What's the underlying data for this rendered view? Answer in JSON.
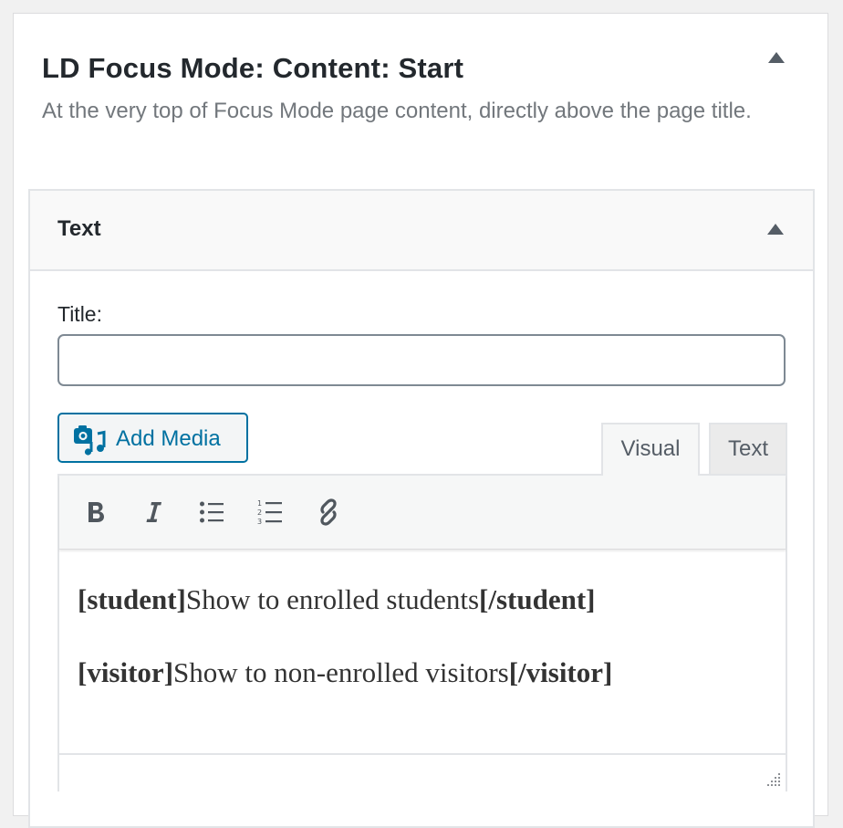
{
  "area": {
    "title": "LD Focus Mode: Content: Start",
    "description": "At the very top of Focus Mode page content, directly above the page title."
  },
  "widget": {
    "title": "Text",
    "title_field_label": "Title:",
    "title_field_value": ""
  },
  "editor": {
    "add_media_label": "Add Media",
    "tabs": {
      "visual": "Visual",
      "text": "Text"
    },
    "toolbar": {
      "bold": "bold-icon",
      "italic": "italic-icon",
      "bullet_list": "bullet-list-icon",
      "numbered_list": "numbered-list-icon",
      "link": "link-icon"
    },
    "lines": [
      {
        "open": "[student]",
        "text": "Show to enrolled students",
        "close": "[/student]"
      },
      {
        "open": "[visitor]",
        "text": "Show to non-enrolled visitors",
        "close": "[/visitor]"
      }
    ]
  },
  "colors": {
    "accent": "#0071a1",
    "text": "#23282d",
    "muted": "#72777c"
  }
}
